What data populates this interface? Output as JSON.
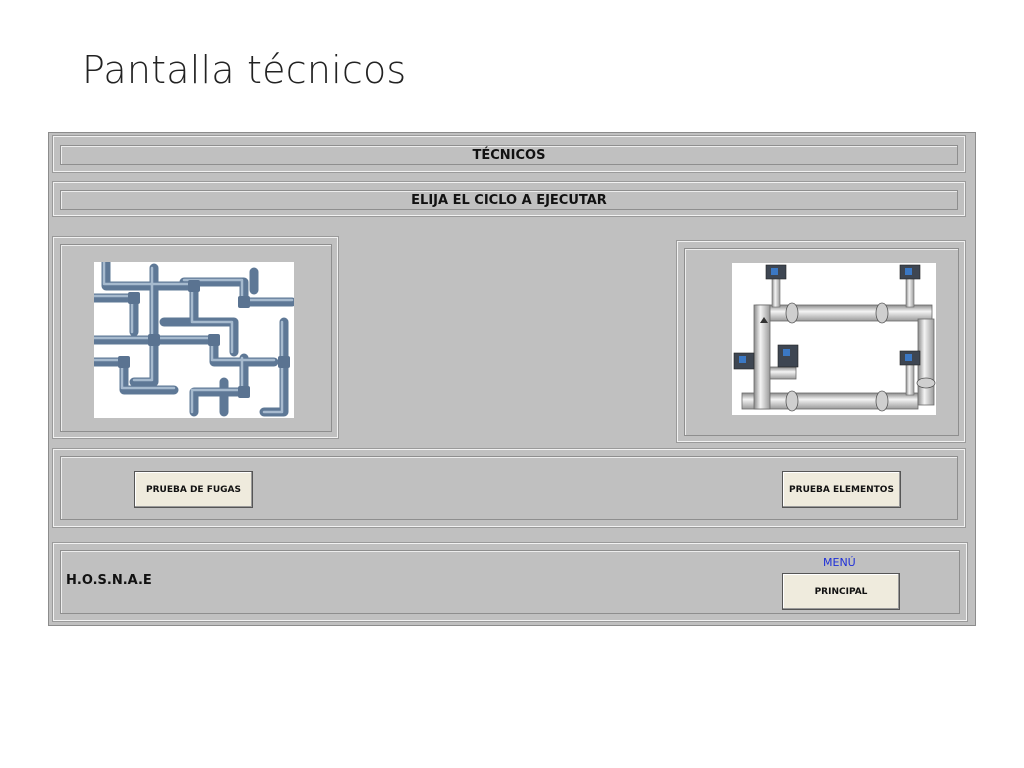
{
  "slide": {
    "title": "Pantalla técnicos"
  },
  "hmi": {
    "header_title": "TÉCNICOS",
    "subheader": "ELIJA EL CICLO A EJECUTAR",
    "buttons": {
      "leak_test": "PRUEBA DE FUGAS",
      "elements_test": "PRUEBA ELEMENTOS",
      "main": "PRINCIPAL"
    },
    "menu_label": "MENÚ",
    "brand": "H.O.S.N.A.E",
    "colors": {
      "panel": "#c0c0c0",
      "button": "#efebdd",
      "menu_text": "#1e2fd8",
      "pipe": "#6f8aa8"
    },
    "images": {
      "left": "pipes-network-illustration",
      "right": "valve-manifold-illustration"
    }
  }
}
